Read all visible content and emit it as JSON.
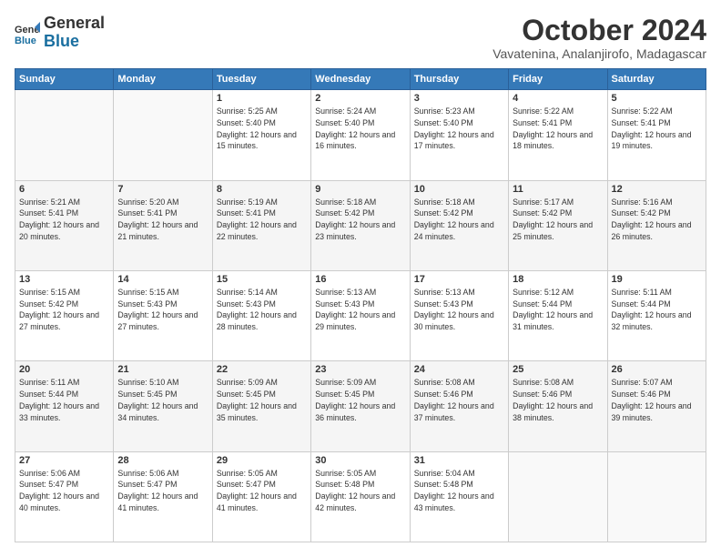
{
  "logo": {
    "general": "General",
    "blue": "Blue"
  },
  "header": {
    "month": "October 2024",
    "location": "Vavatenina, Analanjirofo, Madagascar"
  },
  "days_of_week": [
    "Sunday",
    "Monday",
    "Tuesday",
    "Wednesday",
    "Thursday",
    "Friday",
    "Saturday"
  ],
  "weeks": [
    [
      {
        "day": "",
        "info": ""
      },
      {
        "day": "",
        "info": ""
      },
      {
        "day": "1",
        "info": "Sunrise: 5:25 AM\nSunset: 5:40 PM\nDaylight: 12 hours and 15 minutes."
      },
      {
        "day": "2",
        "info": "Sunrise: 5:24 AM\nSunset: 5:40 PM\nDaylight: 12 hours and 16 minutes."
      },
      {
        "day": "3",
        "info": "Sunrise: 5:23 AM\nSunset: 5:40 PM\nDaylight: 12 hours and 17 minutes."
      },
      {
        "day": "4",
        "info": "Sunrise: 5:22 AM\nSunset: 5:41 PM\nDaylight: 12 hours and 18 minutes."
      },
      {
        "day": "5",
        "info": "Sunrise: 5:22 AM\nSunset: 5:41 PM\nDaylight: 12 hours and 19 minutes."
      }
    ],
    [
      {
        "day": "6",
        "info": "Sunrise: 5:21 AM\nSunset: 5:41 PM\nDaylight: 12 hours and 20 minutes."
      },
      {
        "day": "7",
        "info": "Sunrise: 5:20 AM\nSunset: 5:41 PM\nDaylight: 12 hours and 21 minutes."
      },
      {
        "day": "8",
        "info": "Sunrise: 5:19 AM\nSunset: 5:41 PM\nDaylight: 12 hours and 22 minutes."
      },
      {
        "day": "9",
        "info": "Sunrise: 5:18 AM\nSunset: 5:42 PM\nDaylight: 12 hours and 23 minutes."
      },
      {
        "day": "10",
        "info": "Sunrise: 5:18 AM\nSunset: 5:42 PM\nDaylight: 12 hours and 24 minutes."
      },
      {
        "day": "11",
        "info": "Sunrise: 5:17 AM\nSunset: 5:42 PM\nDaylight: 12 hours and 25 minutes."
      },
      {
        "day": "12",
        "info": "Sunrise: 5:16 AM\nSunset: 5:42 PM\nDaylight: 12 hours and 26 minutes."
      }
    ],
    [
      {
        "day": "13",
        "info": "Sunrise: 5:15 AM\nSunset: 5:42 PM\nDaylight: 12 hours and 27 minutes."
      },
      {
        "day": "14",
        "info": "Sunrise: 5:15 AM\nSunset: 5:43 PM\nDaylight: 12 hours and 27 minutes."
      },
      {
        "day": "15",
        "info": "Sunrise: 5:14 AM\nSunset: 5:43 PM\nDaylight: 12 hours and 28 minutes."
      },
      {
        "day": "16",
        "info": "Sunrise: 5:13 AM\nSunset: 5:43 PM\nDaylight: 12 hours and 29 minutes."
      },
      {
        "day": "17",
        "info": "Sunrise: 5:13 AM\nSunset: 5:43 PM\nDaylight: 12 hours and 30 minutes."
      },
      {
        "day": "18",
        "info": "Sunrise: 5:12 AM\nSunset: 5:44 PM\nDaylight: 12 hours and 31 minutes."
      },
      {
        "day": "19",
        "info": "Sunrise: 5:11 AM\nSunset: 5:44 PM\nDaylight: 12 hours and 32 minutes."
      }
    ],
    [
      {
        "day": "20",
        "info": "Sunrise: 5:11 AM\nSunset: 5:44 PM\nDaylight: 12 hours and 33 minutes."
      },
      {
        "day": "21",
        "info": "Sunrise: 5:10 AM\nSunset: 5:45 PM\nDaylight: 12 hours and 34 minutes."
      },
      {
        "day": "22",
        "info": "Sunrise: 5:09 AM\nSunset: 5:45 PM\nDaylight: 12 hours and 35 minutes."
      },
      {
        "day": "23",
        "info": "Sunrise: 5:09 AM\nSunset: 5:45 PM\nDaylight: 12 hours and 36 minutes."
      },
      {
        "day": "24",
        "info": "Sunrise: 5:08 AM\nSunset: 5:46 PM\nDaylight: 12 hours and 37 minutes."
      },
      {
        "day": "25",
        "info": "Sunrise: 5:08 AM\nSunset: 5:46 PM\nDaylight: 12 hours and 38 minutes."
      },
      {
        "day": "26",
        "info": "Sunrise: 5:07 AM\nSunset: 5:46 PM\nDaylight: 12 hours and 39 minutes."
      }
    ],
    [
      {
        "day": "27",
        "info": "Sunrise: 5:06 AM\nSunset: 5:47 PM\nDaylight: 12 hours and 40 minutes."
      },
      {
        "day": "28",
        "info": "Sunrise: 5:06 AM\nSunset: 5:47 PM\nDaylight: 12 hours and 41 minutes."
      },
      {
        "day": "29",
        "info": "Sunrise: 5:05 AM\nSunset: 5:47 PM\nDaylight: 12 hours and 41 minutes."
      },
      {
        "day": "30",
        "info": "Sunrise: 5:05 AM\nSunset: 5:48 PM\nDaylight: 12 hours and 42 minutes."
      },
      {
        "day": "31",
        "info": "Sunrise: 5:04 AM\nSunset: 5:48 PM\nDaylight: 12 hours and 43 minutes."
      },
      {
        "day": "",
        "info": ""
      },
      {
        "day": "",
        "info": ""
      }
    ]
  ]
}
